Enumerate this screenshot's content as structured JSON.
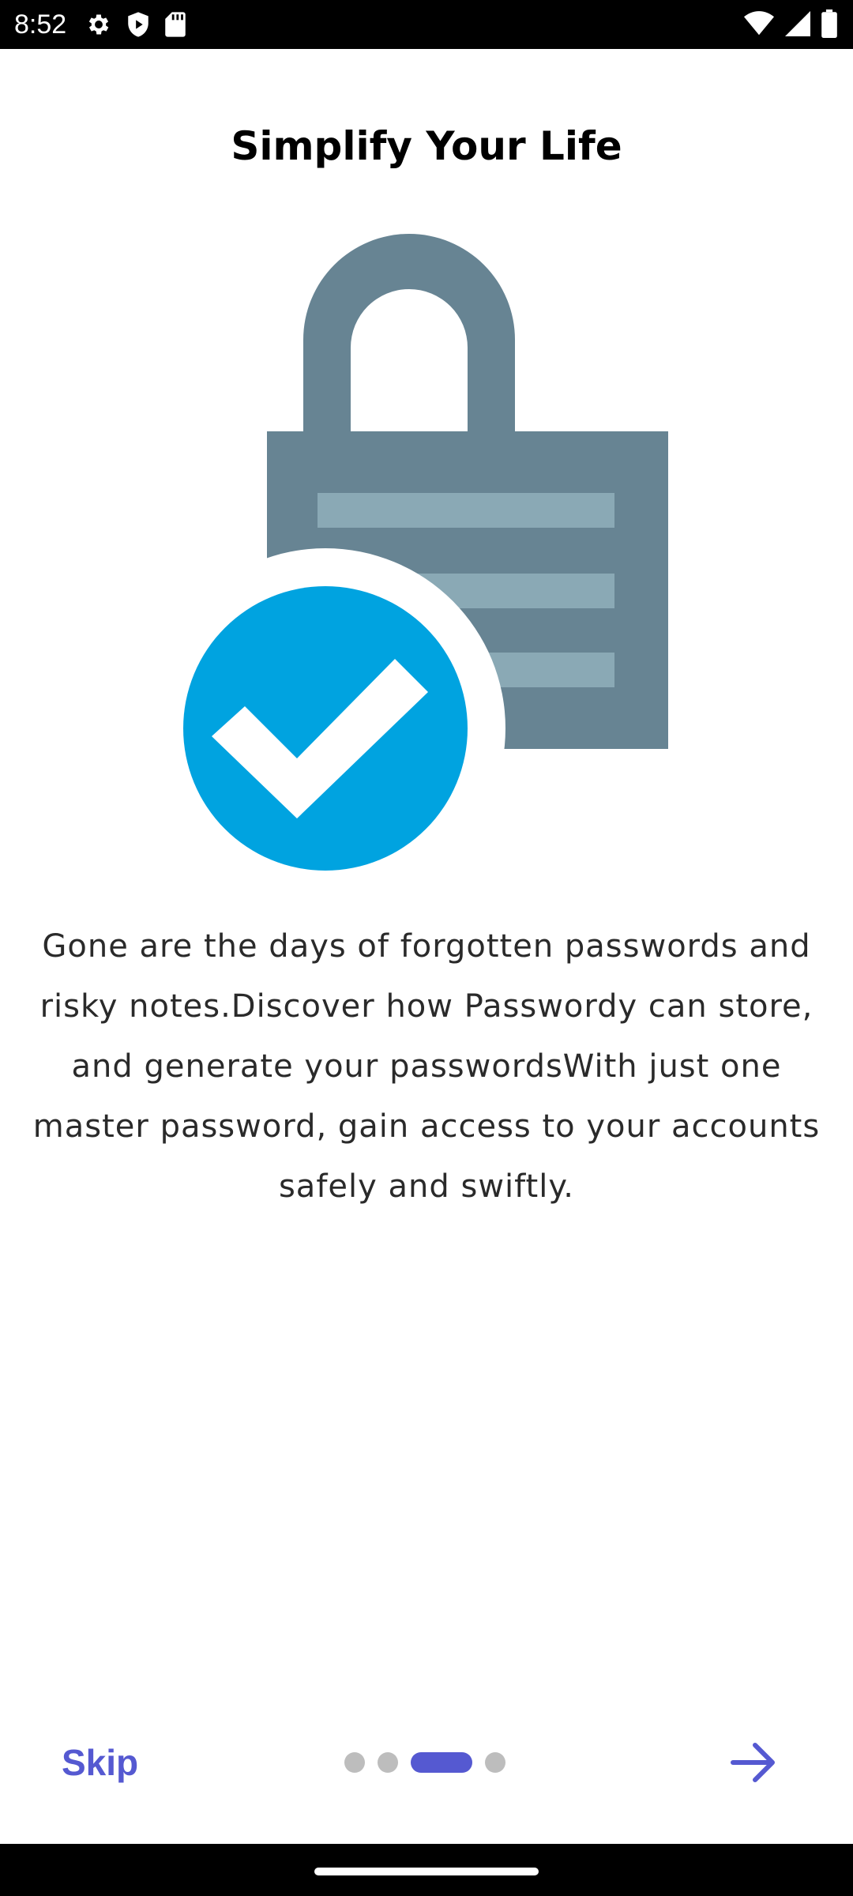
{
  "status_bar": {
    "time": "8:52",
    "left_icons": [
      "settings-gear-icon",
      "shield-icon",
      "sd-card-icon"
    ],
    "right_icons": [
      "wifi-icon",
      "cell-signal-icon",
      "battery-icon"
    ]
  },
  "onboarding": {
    "title": "Simplify Your Life",
    "illustration": {
      "lock_color": "#678493",
      "lock_stripe_color": "#8aa9b5",
      "check_circle_color": "#00a3e0",
      "check_mark_color": "#ffffff"
    },
    "description": "Gone are the days of forgotten passwords and risky notes.Discover how Passwordy can store, and generate your passwordsWith just one master password, gain access to your accounts safely and swiftly."
  },
  "footer": {
    "skip_label": "Skip",
    "page_count": 4,
    "active_page": 3,
    "next_icon": "arrow-right-icon",
    "accent_color": "#5559d1"
  }
}
